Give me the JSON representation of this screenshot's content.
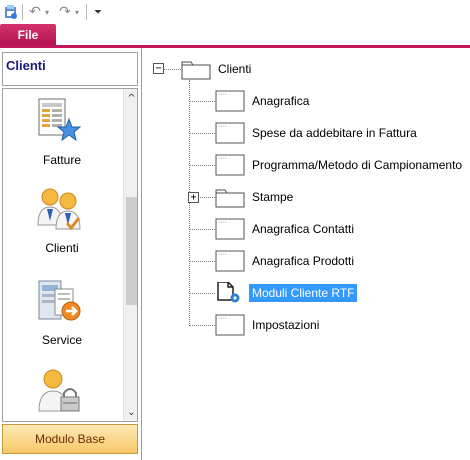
{
  "toolbar": {
    "undo_icon": "undo-icon",
    "redo_icon": "redo-icon",
    "customize_icon": "customize-qat-icon"
  },
  "ribbon": {
    "file_tab": "File"
  },
  "nav": {
    "title": "Clienti",
    "items": [
      {
        "label": "Fatture",
        "icon": "invoice-star-icon"
      },
      {
        "label": "Clienti",
        "icon": "clients-icon"
      },
      {
        "label": "Service",
        "icon": "service-icon"
      },
      {
        "label": "",
        "icon": "user-lock-icon"
      }
    ],
    "module_button": "Modulo Base"
  },
  "tree": {
    "root": {
      "label": "Clienti",
      "expanded": true
    },
    "children": [
      {
        "label": "Anagrafica",
        "icon": "form-icon"
      },
      {
        "label": "Spese da addebitare in Fattura",
        "icon": "form-icon"
      },
      {
        "label": "Programma/Metodo di Campionamento",
        "icon": "form-icon"
      },
      {
        "label": "Stampe",
        "icon": "folder-icon",
        "expandable": true
      },
      {
        "label": "Anagrafica Contatti",
        "icon": "form-icon"
      },
      {
        "label": "Anagrafica Prodotti",
        "icon": "form-icon"
      },
      {
        "label": "Moduli Cliente RTF",
        "icon": "document-gear-icon",
        "selected": true
      },
      {
        "label": "Impostazioni",
        "icon": "form-icon"
      }
    ]
  },
  "colors": {
    "file_tab": "#c2185b",
    "selection": "#3399ff",
    "nav_title": "#1a1a7a",
    "module_button": "#f8c86a"
  }
}
